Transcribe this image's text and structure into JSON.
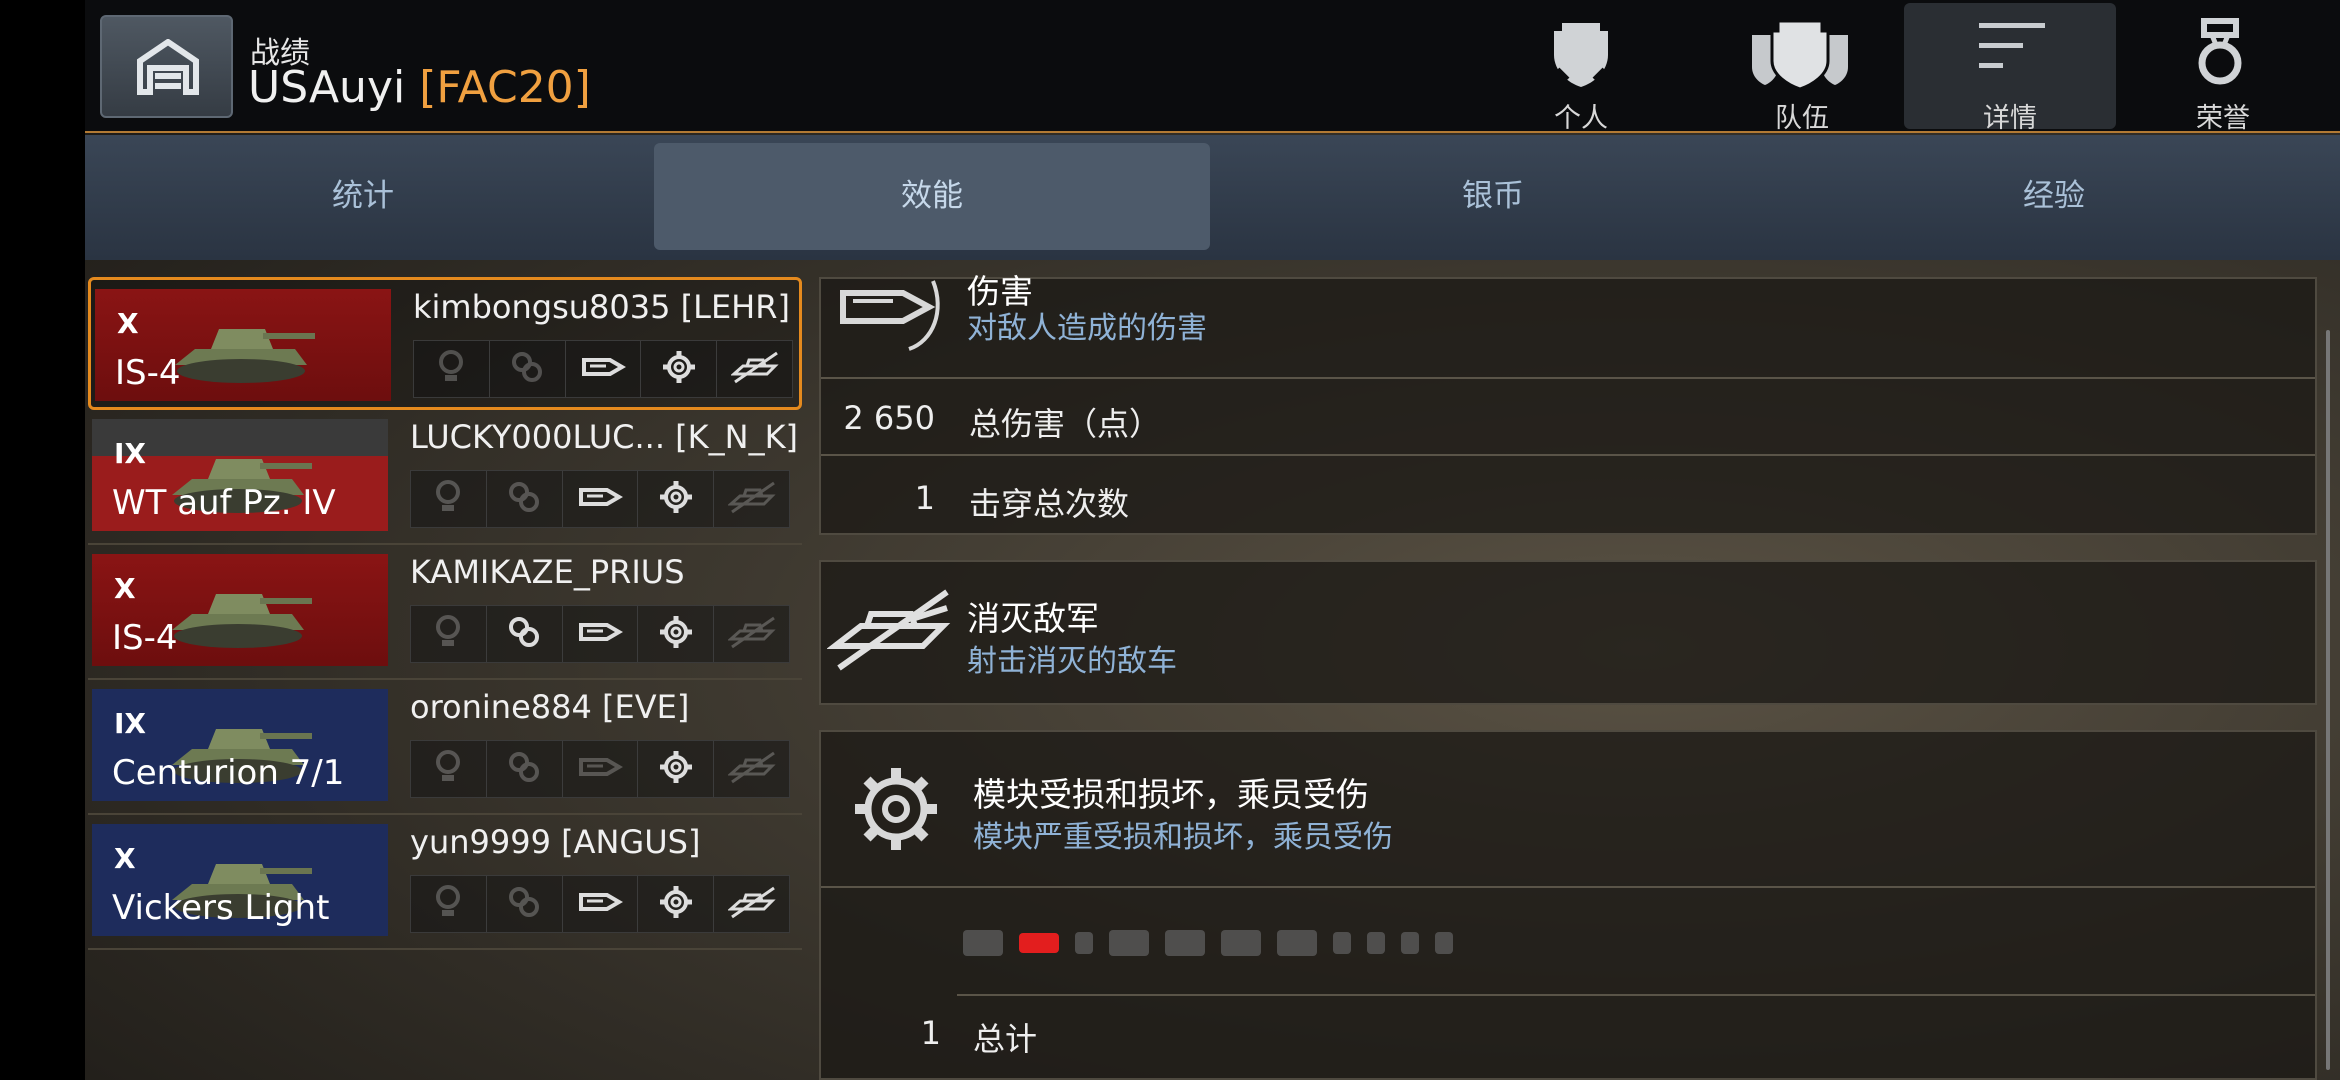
{
  "header": {
    "section_label": "战绩",
    "player_name": "USAuyi",
    "clan_tag": "[FAC20]",
    "nav": [
      {
        "label": "个人",
        "icon": "personal-shield-icon"
      },
      {
        "label": "队伍",
        "icon": "team-shields-icon"
      },
      {
        "label": "详情",
        "icon": "details-lines-icon",
        "active": true
      },
      {
        "label": "荣誉",
        "icon": "medal-icon"
      }
    ]
  },
  "tabs": [
    {
      "label": "统计"
    },
    {
      "label": "效能",
      "active": true
    },
    {
      "label": "银币"
    },
    {
      "label": "经验"
    }
  ],
  "players": [
    {
      "tier": "X",
      "vehicle": "IS-4",
      "name": "kimbongsu8035 [LEHR]",
      "flag": "ussr",
      "selected": true,
      "icons_on": [
        false,
        false,
        true,
        true,
        true
      ]
    },
    {
      "tier": "IX",
      "vehicle": "WT auf Pz. IV",
      "name": "LUCKY000LUC... [K_N_K]",
      "flag": "germany",
      "icons_on": [
        false,
        false,
        true,
        true,
        false
      ]
    },
    {
      "tier": "X",
      "vehicle": "IS-4",
      "name": "KAMIKAZE_PRIUS",
      "flag": "ussr",
      "icons_on": [
        false,
        true,
        true,
        true,
        false
      ]
    },
    {
      "tier": "IX",
      "vehicle": "Centurion 7/1",
      "name": "oronine884 [EVE]",
      "flag": "uk",
      "icons_on": [
        false,
        false,
        false,
        true,
        false
      ]
    },
    {
      "tier": "X",
      "vehicle": "Vickers Light",
      "name": "yun9999 [ANGUS]",
      "flag": "uk",
      "icons_on": [
        false,
        false,
        true,
        true,
        true
      ]
    }
  ],
  "damage": {
    "title": "伤害",
    "desc": "对敌人造成的伤害",
    "total_value": "2 650",
    "total_label": "总伤害（点）",
    "pen_value": "1",
    "pen_label": "击穿总次数"
  },
  "kills": {
    "title": "消灭敌军",
    "desc": "射击消灭的敌车"
  },
  "modules": {
    "title": "模块受损和损坏，乘员受伤",
    "desc": "模块严重受损和损坏，乘员受伤",
    "total_value": "1",
    "total_label": "总计"
  }
}
